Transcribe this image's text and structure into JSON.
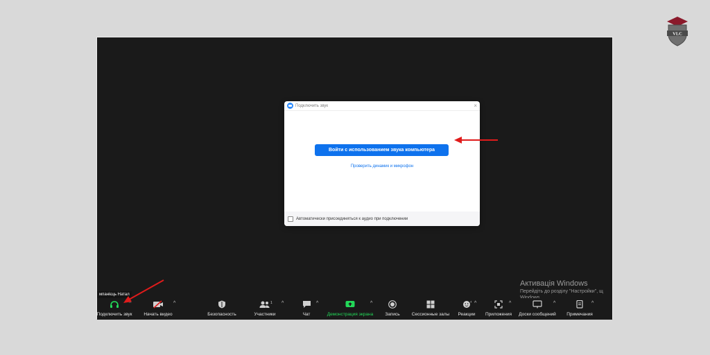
{
  "logo": {
    "text": "VLC",
    "icon": "graduation-cap-shield-icon"
  },
  "dialog": {
    "title": "Подключить звук",
    "close": "×",
    "join_button": "Войти с использованием звука компьютера",
    "test_link": "Проверить динамик и микрофон",
    "auto_join_label": "Автоматически присоединяться к аудио при подключении"
  },
  "participant_name": "мпанієць Натал",
  "windows": {
    "title": "Активація Windows",
    "subtitle": "Перейдіть до розділу \"Настройки\", щ",
    "subtitle2": "Windows."
  },
  "toolbar": {
    "caret": "^",
    "audio": "Подключить звук",
    "video": "Начать видео",
    "security": "Безопасность",
    "participants": "Участники",
    "participants_count": "1",
    "chat": "Чат",
    "share": "Демонстрация экрана",
    "record": "Запись",
    "breakout": "Сессионные залы",
    "reactions": "Реакции",
    "apps": "Приложения",
    "whiteboards": "Доски сообщений",
    "notes": "Примечания"
  },
  "colors": {
    "accent": "#0e72ed",
    "share_green": "#23d959",
    "arrow_red": "#e01b1b"
  }
}
